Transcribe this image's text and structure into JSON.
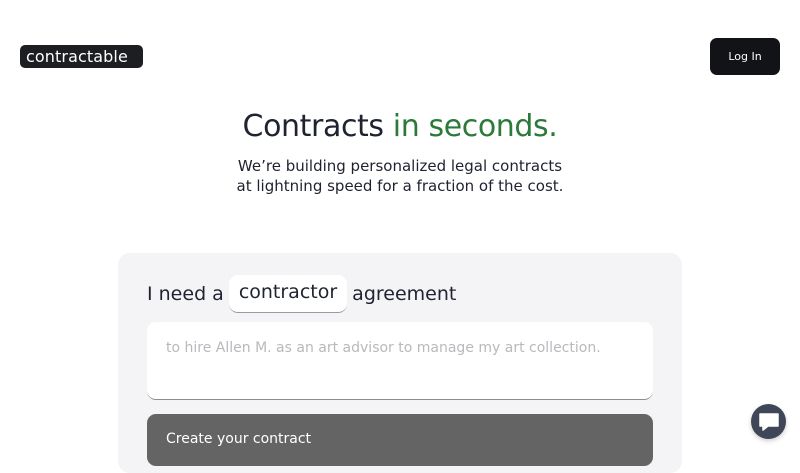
{
  "header": {
    "logo_text": "contractable",
    "login_label": "Log In"
  },
  "hero": {
    "title_main": "Contracts ",
    "title_accent": "in seconds.",
    "subtitle_line1": "We’re building personalized legal contracts",
    "subtitle_line2": "at lightning speed for a fraction of the cost."
  },
  "form": {
    "prefix": "I need a",
    "contract_type": "contractor",
    "suffix": "agreement",
    "purpose_placeholder": "to hire Allen M. as an art advisor to manage my art collection.",
    "create_label": "Create your contract"
  },
  "chat": {
    "icon": "chat-bubble-icon"
  },
  "colors": {
    "accent": "#2c7a3a",
    "dark": "#121316",
    "card_bg": "#f4f4f6",
    "button_gray": "#646465",
    "chat_bg": "#3f4657"
  }
}
